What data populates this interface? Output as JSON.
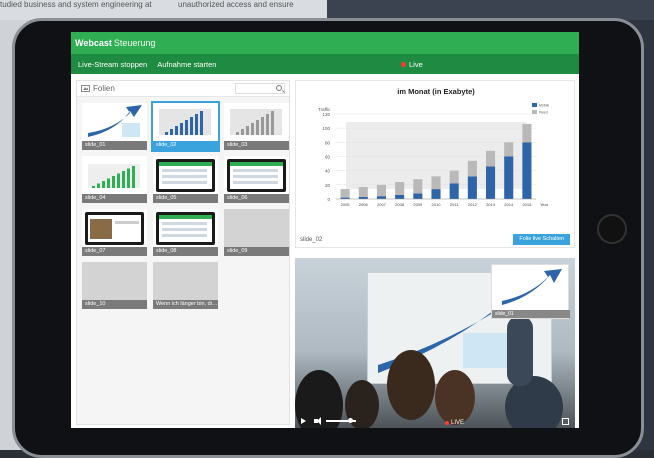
{
  "background": {
    "left_text": "tudied business and system engineering at",
    "right_text": "unauthorized access and ensure"
  },
  "header": {
    "title_bold": "Webcast",
    "title_rest": "Steuerung"
  },
  "menu": {
    "stop_stream": "Live-Stream stoppen",
    "start_recording": "Aufnahme starten",
    "live_label": "Live"
  },
  "slides_panel": {
    "title": "Folien",
    "slides": [
      {
        "label": "slide_01"
      },
      {
        "label": "slide_02",
        "selected": true
      },
      {
        "label": "slide_03"
      },
      {
        "label": "slide_04"
      },
      {
        "label": "slide_05"
      },
      {
        "label": "slide_06"
      },
      {
        "label": "slide_07"
      },
      {
        "label": "slide_08"
      },
      {
        "label": "slide_09"
      },
      {
        "label": "slide_10"
      },
      {
        "label": "Wenn ich länger bin, di…"
      }
    ]
  },
  "preview": {
    "slide_label": "slide_02",
    "live_button": "Folie live Schalten"
  },
  "chart_data": {
    "type": "bar",
    "title": "im Monat (in Exabyte)",
    "ylabel": "Traffic",
    "xlabel": "Year",
    "ylim": [
      0,
      120
    ],
    "yticks": [
      0,
      20,
      40,
      60,
      80,
      100,
      120
    ],
    "categories": [
      "2005",
      "2006",
      "2007",
      "2008",
      "2009",
      "2010",
      "2011",
      "2012",
      "2013",
      "2014",
      "2015"
    ],
    "series": [
      {
        "name": "Mobile",
        "color": "#2e64a8",
        "values": [
          2,
          3,
          4,
          6,
          8,
          14,
          22,
          32,
          46,
          60,
          80
        ]
      },
      {
        "name": "Fixed",
        "color": "#b9b9b9",
        "values": [
          12,
          14,
          16,
          18,
          20,
          18,
          18,
          22,
          22,
          20,
          26
        ]
      }
    ],
    "legend": [
      "Mobile",
      "Fixed"
    ],
    "legend_position": "top-right"
  },
  "video": {
    "pip_label": "slide_01",
    "live_label": "LIVE"
  }
}
